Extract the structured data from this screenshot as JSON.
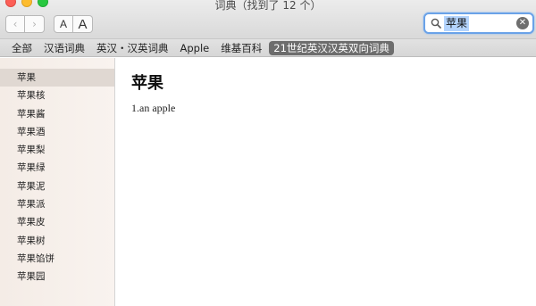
{
  "window": {
    "title": "词典（找到了 12 个）"
  },
  "toolbar": {
    "back_icon": "chevron-left-icon",
    "forward_icon": "chevron-right-icon",
    "font_small_label": "A",
    "font_large_label": "A",
    "back_glyph": "‹",
    "forward_glyph": "›"
  },
  "search": {
    "value": "苹果",
    "icon": "search-icon",
    "clear_icon": "clear-icon",
    "accent_color": "#6aa2e8"
  },
  "tabs": [
    {
      "label": "全部"
    },
    {
      "label": "汉语词典"
    },
    {
      "label": "英汉・汉英词典"
    },
    {
      "label": "Apple"
    },
    {
      "label": "维基百科"
    },
    {
      "label": "21世纪英汉汉英双向词典",
      "active": true
    }
  ],
  "sidebar": {
    "items": [
      {
        "label": "苹果",
        "selected": true
      },
      {
        "label": "苹果核"
      },
      {
        "label": "苹果酱"
      },
      {
        "label": "苹果酒"
      },
      {
        "label": "苹果梨"
      },
      {
        "label": "苹果绿"
      },
      {
        "label": "苹果泥"
      },
      {
        "label": "苹果派"
      },
      {
        "label": "苹果皮"
      },
      {
        "label": "苹果树"
      },
      {
        "label": "苹果馅饼"
      },
      {
        "label": "苹果园"
      }
    ]
  },
  "entry": {
    "headword": "苹果",
    "definition": "1.an apple"
  }
}
